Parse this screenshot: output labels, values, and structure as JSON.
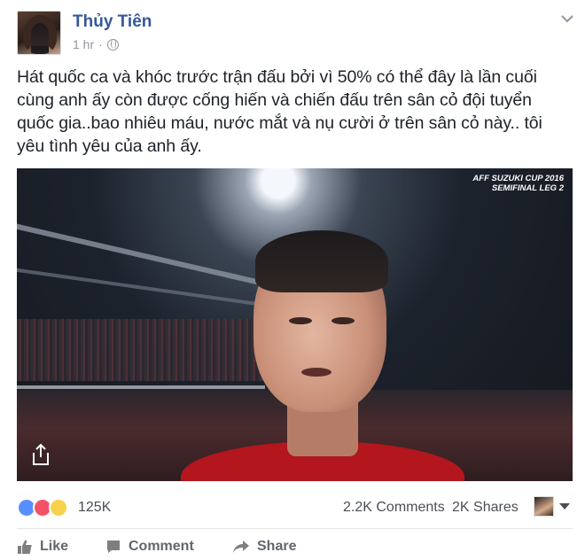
{
  "post": {
    "author": "Thủy Tiên",
    "time": "1 hr",
    "separator": "·",
    "message": "Hát quốc ca và khóc trước trận đấu bởi vì 50% có thể đây là lần cuối cùng anh ấy còn được cống hiến và chiến đấu trên sân cỏ đội tuyển quốc gia..bao nhiêu máu, nước mắt và nụ cười ở trên sân cỏ này.. tôi yêu tình yêu của anh ấy.",
    "media_overlay": {
      "line1": "AFF SUZUKI CUP 2016",
      "line2": "SEMIFINAL LEG 2"
    }
  },
  "stats": {
    "reaction_count": "125K",
    "comments": "2.2K Comments",
    "shares": "2K Shares",
    "reaction_icons": [
      "like-icon",
      "love-icon",
      "sad-icon"
    ]
  },
  "actions": {
    "like_label": "Like",
    "comment_label": "Comment",
    "share_label": "Share"
  },
  "colors": {
    "author": "#365899",
    "meta": "#90949c",
    "text": "#1d2129",
    "action": "#616770",
    "like": "#5890ff",
    "love": "#f25268",
    "sad": "#f7d24a"
  }
}
